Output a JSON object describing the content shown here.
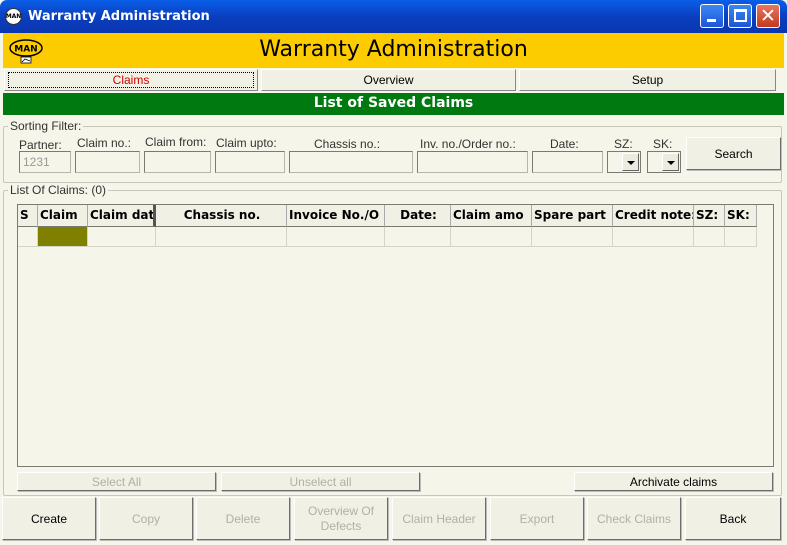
{
  "window": {
    "title": "Warranty Administration",
    "icon": "man-logo-icon"
  },
  "header": {
    "title": "Warranty Administration",
    "logo_text": "MAN",
    "brand_color": "#fccc00"
  },
  "tabs": [
    {
      "label": "Claims",
      "active": true
    },
    {
      "label": "Overview",
      "active": false
    },
    {
      "label": "Setup",
      "active": false
    }
  ],
  "banner": {
    "title": "List of Saved Claims",
    "color": "#007a10"
  },
  "filter": {
    "legend": "Sorting Filter:",
    "partner_label": "Partner:",
    "partner_value": "1231",
    "claim_no_label": "Claim no.:",
    "claim_from_label": "Claim from:",
    "claim_upto_label": "Claim upto:",
    "chassis_label": "Chassis no.:",
    "inv_label": "Inv. no./Order no.:",
    "date_label": "Date:",
    "sz_label": "SZ:",
    "sk_label": "SK:",
    "search_label": "Search"
  },
  "list": {
    "legend": "List Of Claims: (0)",
    "columns": [
      "S",
      "Claim",
      "Claim dat",
      "Chassis no.",
      "Invoice No./O",
      "Date:",
      "Claim amo",
      "Spare part",
      "Credit note:",
      "SZ:",
      "SK:"
    ],
    "rows": [
      [
        "",
        "",
        "",
        "",
        "",
        "",
        "",
        "",
        "",
        "",
        ""
      ]
    ]
  },
  "list_actions": {
    "select_all": "Select All",
    "unselect_all": "Unselect all",
    "archivate": "Archivate claims"
  },
  "toolbar": {
    "create": "Create",
    "copy": "Copy",
    "delete": "Delete",
    "overview_defects": "Overview Of Defects",
    "claim_header": "Claim Header",
    "export": "Export",
    "check_claims": "Check Claims",
    "back": "Back"
  }
}
